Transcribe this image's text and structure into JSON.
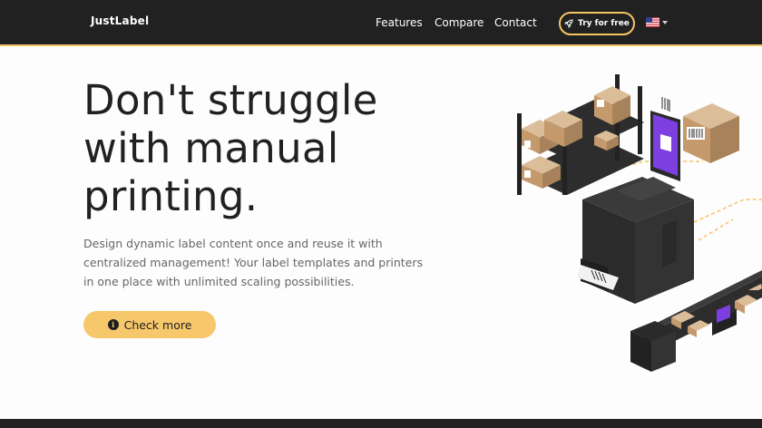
{
  "nav": {
    "logo": "JustLabel",
    "links": [
      "Features",
      "Compare",
      "Contact"
    ],
    "cta_label": "Try for free",
    "cta_icon": "rocket-icon",
    "language_icon": "us-flag-icon"
  },
  "hero": {
    "title": "Don't struggle with manual printing.",
    "description": "Design dynamic label content once and reuse it with centralized management! Your label templates and printers in one place with unlimited scaling possibilities.",
    "button_label": "Check more",
    "button_icon": "info-icon"
  },
  "colors": {
    "accent": "#f6c462",
    "dark": "#212121",
    "text": "#212121",
    "muted": "#666666",
    "purple": "#7d3fe0"
  }
}
